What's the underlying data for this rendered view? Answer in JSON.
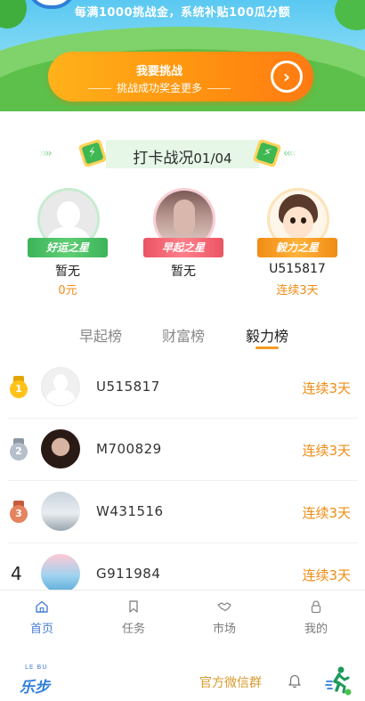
{
  "banner": {
    "notice": "每满1000挑战金，系统补贴100瓜分额",
    "challenge_title": "我要挑战",
    "challenge_subtitle": "挑战成功奖金更多",
    "arrow_glyph": "›"
  },
  "checkin": {
    "title": "打卡战况",
    "count": "01/04"
  },
  "podium": [
    {
      "star": "好运之星",
      "name": "暂无",
      "value": "0元"
    },
    {
      "star": "早起之星",
      "name": "暂无",
      "value": ""
    },
    {
      "star": "毅力之星",
      "name": "U515817",
      "value": "连续3天"
    }
  ],
  "tabs": {
    "early": "早起榜",
    "wealth": "财富榜",
    "streak": "毅力榜",
    "active": "streak"
  },
  "ranking": [
    {
      "rank": "1",
      "name": "U515817",
      "streak": "连续3天"
    },
    {
      "rank": "2",
      "name": "M700829",
      "streak": "连续3天"
    },
    {
      "rank": "3",
      "name": "W431516",
      "streak": "连续3天"
    },
    {
      "rank": "4",
      "name": "G911984",
      "streak": "连续3天"
    }
  ],
  "tabbar": {
    "home": "首页",
    "tasks": "任务",
    "market": "市场",
    "mine": "我的",
    "active": "home"
  },
  "footer": {
    "logo_small": "LE BU",
    "logo_text": "乐步",
    "wechat_group": "官方微信群"
  },
  "colors": {
    "accent_orange": "#f08c14",
    "active_blue": "#4a7fd4",
    "challenge_gradient_start": "#ffb21a",
    "challenge_gradient_end": "#ff7a12"
  }
}
